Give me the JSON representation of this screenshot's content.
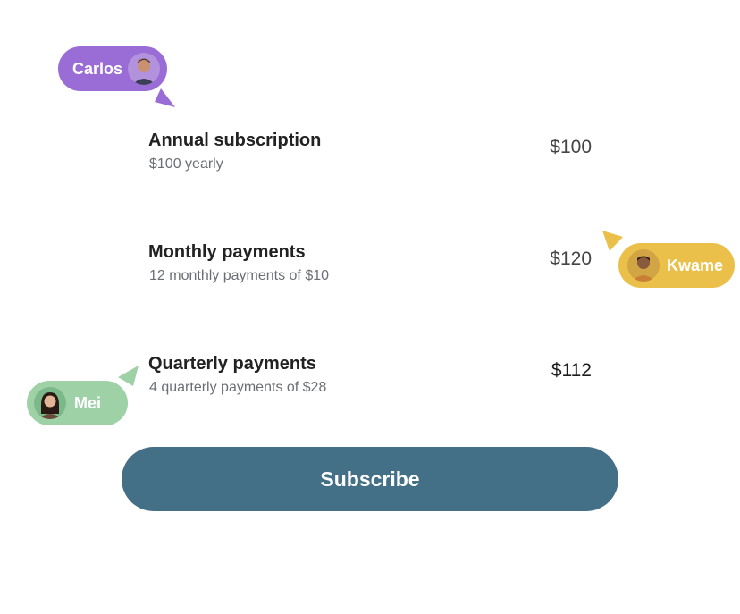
{
  "plans": [
    {
      "title": "Annual subscription",
      "subtitle": "$100 yearly",
      "price": "$100"
    },
    {
      "title": "Monthly payments",
      "subtitle": "12 monthly payments of $10",
      "price": "$120"
    },
    {
      "title": "Quarterly payments",
      "subtitle": "4 quarterly payments of $28",
      "price": "$112"
    }
  ],
  "subscribe_label": "Subscribe",
  "collaborators": {
    "carlos": {
      "name": "Carlos",
      "color": "#9a6cd6",
      "avatar_icon": "user-avatar-icon"
    },
    "kwame": {
      "name": "Kwame",
      "color": "#ebc04a",
      "avatar_icon": "user-avatar-icon"
    },
    "mei": {
      "name": "Mei",
      "color": "#9ed1a6",
      "avatar_icon": "user-avatar-icon"
    }
  },
  "colors": {
    "accent_button": "#436f87"
  }
}
